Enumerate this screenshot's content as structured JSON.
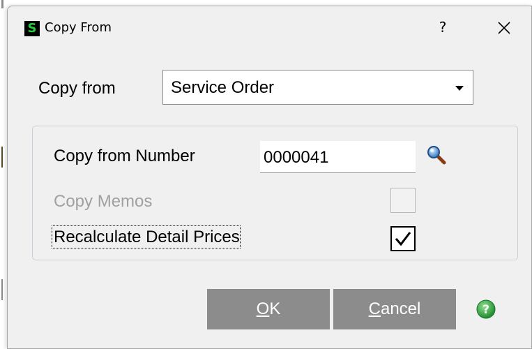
{
  "dialog": {
    "title": "Copy From",
    "app_icon_letter": "S",
    "help_symbol": "?",
    "close_symbol": "✕"
  },
  "copy_from": {
    "label": "Copy from",
    "selected": "Service Order"
  },
  "group": {
    "number_label": "Copy from Number",
    "number_value": "0000041",
    "memos_label": "Copy Memos",
    "memos_checked": false,
    "memos_enabled": false,
    "recalc_label": "Recalculate Detail Prices",
    "recalc_checked": true
  },
  "buttons": {
    "ok_mnemonic": "O",
    "ok_rest": "K",
    "cancel_mnemonic": "C",
    "cancel_rest": "ancel"
  },
  "colors": {
    "app_icon_bg": "#000000",
    "app_icon_fg": "#22d13a",
    "button_bg": "#8c8c8c",
    "help_icon": "#2e9e3a",
    "disabled_text": "#a0a0a0"
  },
  "icons": {
    "lookup": "magnifier-icon",
    "help": "green-help-icon",
    "close": "close-icon",
    "dropdown": "dropdown-arrow-icon"
  }
}
